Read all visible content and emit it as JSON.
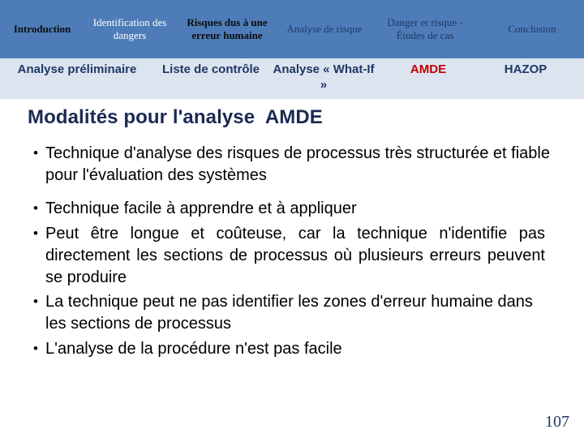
{
  "nav": {
    "items": [
      {
        "label": "Introduction",
        "style": "black"
      },
      {
        "label": "Identification des dangers",
        "style": "white"
      },
      {
        "label": "Risques dus à une erreur humaine",
        "style": "black"
      },
      {
        "label": "Analyse de risque",
        "style": "navy"
      },
      {
        "label": "Danger et risque - Études de cas",
        "style": "navy"
      },
      {
        "label": "Conclusion",
        "style": "navy"
      }
    ]
  },
  "subnav": {
    "items": [
      {
        "label": "Analyse préliminaire",
        "color": "#1f3864"
      },
      {
        "label": "Liste de contrôle",
        "color": "#1f3864"
      },
      {
        "label": "Analyse « What-If »",
        "color": "#1f3864"
      },
      {
        "label": "AMDE",
        "color": "#c00000"
      },
      {
        "label": "HAZOP",
        "color": "#1f3864"
      }
    ]
  },
  "slide": {
    "title": "Modalités pour l'analyse  AMDE",
    "bullet_marker": "•",
    "bullets": [
      "Technique d'analyse des risques de processus très structurée et fiable pour l'évaluation des systèmes",
      "Technique facile à apprendre et à appliquer",
      "Peut être longue et coûteuse, car la technique n'identifie pas directement les sections de processus où plusieurs erreurs peuvent se produire",
      "La technique peut ne pas identifier les zones d'erreur humaine dans les sections de processus",
      "L'analyse de la procédure n'est pas facile"
    ],
    "page_number": "107"
  },
  "colors": {
    "nav_band": "#4d7cb9",
    "sub_band": "#dce4f0",
    "navy": "#1f3864",
    "accent_red": "#c00000",
    "title": "#1b2a52"
  }
}
